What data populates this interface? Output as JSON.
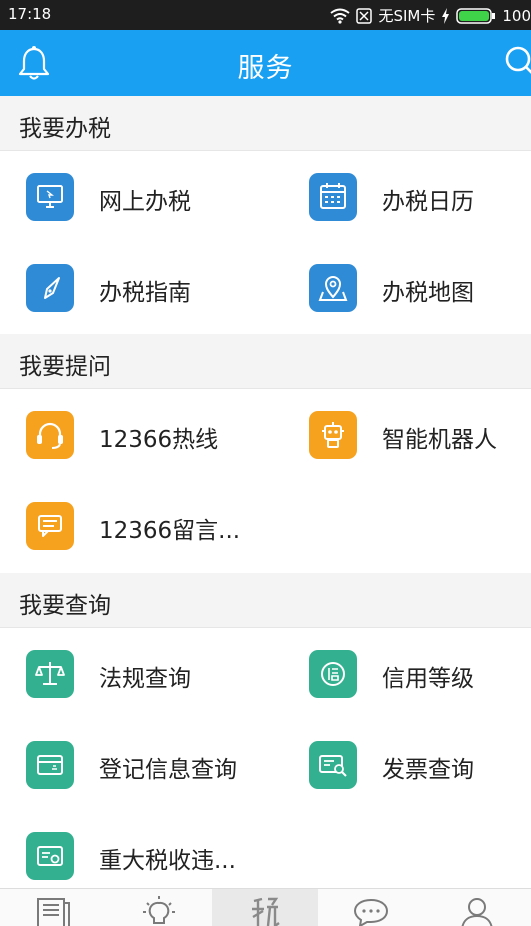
{
  "status_bar": {
    "time": "17:18",
    "carrier": "无SIM卡",
    "battery": "100",
    "icons": [
      "wifi-icon",
      "no-sim-icon",
      "charging-icon",
      "battery-icon"
    ]
  },
  "header": {
    "title": "服务",
    "left_icon": "bell-icon",
    "right_icon": "search-icon",
    "color": "#1aa0f3"
  },
  "sections": [
    {
      "title": "我要办税",
      "items": [
        {
          "label": "网上办税",
          "icon": "computer-icon",
          "color": "#2f8bd6"
        },
        {
          "label": "办税日历",
          "icon": "calendar-icon",
          "color": "#2f8bd6"
        },
        {
          "label": "办税指南",
          "icon": "compass-icon",
          "color": "#2f8bd6"
        },
        {
          "label": "办税地图",
          "icon": "map-pin-icon",
          "color": "#2f8bd6"
        }
      ]
    },
    {
      "title": "我要提问",
      "items": [
        {
          "label": "12366热线",
          "icon": "headset-icon",
          "color": "#f6a21e"
        },
        {
          "label": "智能机器人",
          "icon": "robot-icon",
          "color": "#f6a21e"
        },
        {
          "label": "12366留言...",
          "icon": "message-icon",
          "color": "#f6a21e"
        }
      ]
    },
    {
      "title": "我要查询",
      "items": [
        {
          "label": "法规查询",
          "icon": "scales-icon",
          "color": "#33b08f"
        },
        {
          "label": "信用等级",
          "icon": "credit-icon",
          "color": "#33b08f"
        },
        {
          "label": "登记信息查询",
          "icon": "registration-card-icon",
          "color": "#33b08f"
        },
        {
          "label": "发票查询",
          "icon": "invoice-search-icon",
          "color": "#33b08f"
        },
        {
          "label": "重大税收违...",
          "icon": "tax-violation-icon",
          "color": "#33b08f"
        }
      ]
    }
  ],
  "tab_bar": {
    "tabs": [
      {
        "icon": "news-icon",
        "active": false
      },
      {
        "icon": "lightbulb-icon",
        "active": false
      },
      {
        "icon": "tax-service-icon",
        "active": true
      },
      {
        "icon": "chat-icon",
        "active": false
      },
      {
        "icon": "user-icon",
        "active": false
      }
    ]
  }
}
